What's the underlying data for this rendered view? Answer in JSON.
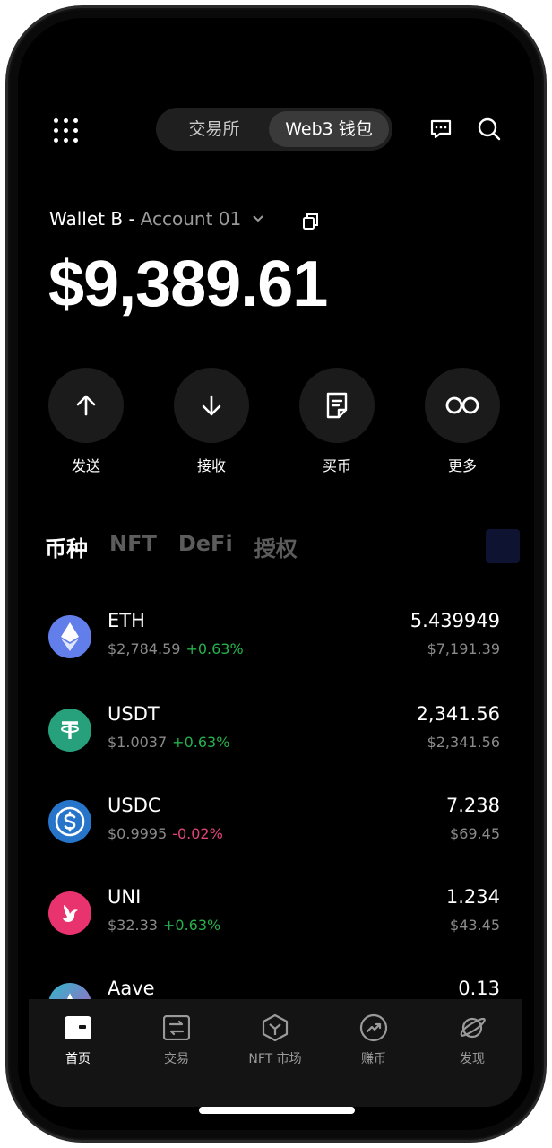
{
  "topbar": {
    "tabs": [
      {
        "label": "交易所"
      },
      {
        "label": "Web3 钱包"
      }
    ]
  },
  "wallet": {
    "name": "Wallet B -",
    "account": "Account 01",
    "balance": "$9,389.61"
  },
  "actions": [
    {
      "label": "发送",
      "icon": "arrow-up-icon"
    },
    {
      "label": "接收",
      "icon": "arrow-down-icon"
    },
    {
      "label": "买币",
      "icon": "receipt-icon"
    },
    {
      "label": "更多",
      "icon": "infinity-icon"
    }
  ],
  "categories": [
    "币种",
    "NFT",
    "DeFi",
    "授权"
  ],
  "tokens": [
    {
      "symbol": "ETH",
      "price": "$2,784.59",
      "change": "+0.63%",
      "amount": "5.439949",
      "value": "$7,191.39",
      "color": "#627eea"
    },
    {
      "symbol": "USDT",
      "price": "$1.0037",
      "change": "+0.63%",
      "amount": "2,341.56",
      "value": "$2,341.56",
      "color": "#26a17b"
    },
    {
      "symbol": "USDC",
      "price": "$0.9995",
      "change": "-0.02%",
      "amount": "7.238",
      "value": "$69.45",
      "color": "#2775ca"
    },
    {
      "symbol": "UNI",
      "price": "$32.33",
      "change": "+0.63%",
      "amount": "1.234",
      "value": "$43.45",
      "color": "#e8336f"
    },
    {
      "symbol": "Aave",
      "price": "",
      "change": "",
      "amount": "0.13",
      "value": "",
      "color": "#7a5bd0"
    }
  ],
  "nav": [
    {
      "label": "首页",
      "icon": "wallet-icon"
    },
    {
      "label": "交易",
      "icon": "trade-icon"
    },
    {
      "label": "NFT 市场",
      "icon": "nft-icon"
    },
    {
      "label": "赚币",
      "icon": "earn-icon"
    },
    {
      "label": "发现",
      "icon": "planet-icon"
    }
  ],
  "colors": {
    "up": "#25b14c",
    "down": "#e0447a",
    "background": "#000000"
  }
}
